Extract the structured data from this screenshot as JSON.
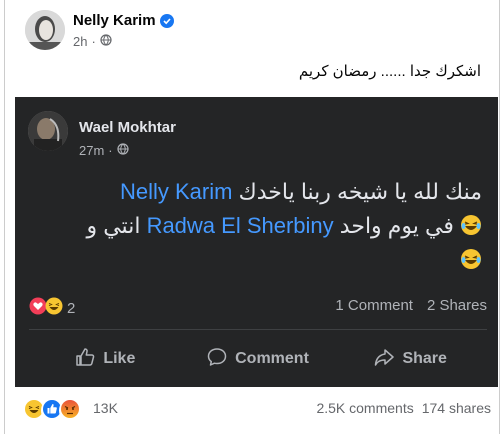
{
  "post": {
    "author": "Nelly Karim",
    "time": "2h",
    "caption": "اشكرك جدا ...... رمضان كريم"
  },
  "shared": {
    "author": "Wael Mokhtar",
    "time": "27m",
    "text_line1_prefix": "منك لله يا شيخه ربنا ياخدك",
    "mention1": "Nelly Karim",
    "text_line2_prefix": "في يوم واحد",
    "mention2": "Radwa El Sherbiny",
    "text_line2_suffix": "انتي و",
    "reaction_count": "2",
    "comments": "1 Comment",
    "shares": "2 Shares",
    "actions": {
      "like": "Like",
      "comment": "Comment",
      "share": "Share"
    }
  },
  "stats": {
    "reaction_count": "13K",
    "comments": "2.5K comments",
    "shares": "174 shares"
  },
  "colors": {
    "accent": "#1877f2",
    "mention": "#4599ff",
    "dark_card": "#242526"
  }
}
